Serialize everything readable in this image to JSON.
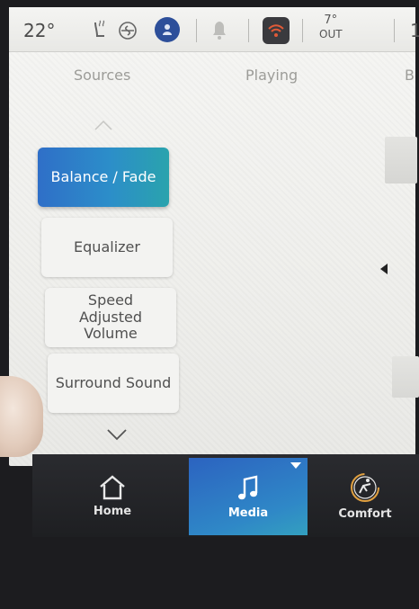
{
  "status": {
    "inside_temp": "22°",
    "outside_temp": "7°",
    "outside_label": "OUT",
    "clipped_number": "1"
  },
  "tabs": {
    "sources": "Sources",
    "playing": "Playing",
    "clipped": "B"
  },
  "menu": {
    "items": [
      {
        "label": "Balance / Fade",
        "active": true
      },
      {
        "label": "Equalizer",
        "active": false
      },
      {
        "label": "Speed Adjusted Volume",
        "active": false
      },
      {
        "label": "Surround Sound",
        "active": false
      }
    ]
  },
  "nav": {
    "home": "Home",
    "media": "Media",
    "comfort": "Comfort"
  },
  "colors": {
    "accent": "#2f7cc7",
    "profile": "#2d4f9a"
  },
  "icons": [
    "seat-heat-icon",
    "fan-icon",
    "profile-icon",
    "bell-icon",
    "wifi-icon",
    "home-icon",
    "music-note-icon",
    "comfort-icon"
  ]
}
